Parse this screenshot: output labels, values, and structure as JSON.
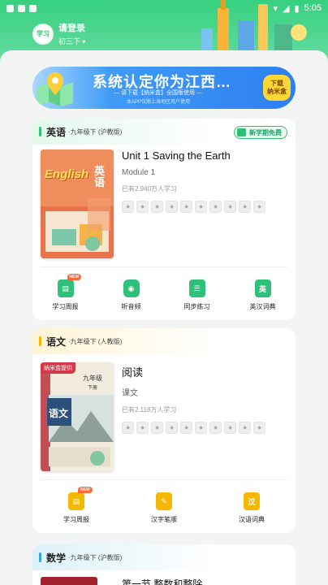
{
  "status_bar": {
    "time": "5:05"
  },
  "header": {
    "avatar_text": "学习",
    "login_label": "请登录",
    "grade_label": "初三下"
  },
  "banner": {
    "title": "系统认定你为江西…",
    "subtitle": "— 请下载【纳米盒】全国版使用 —",
    "note": "本APP仅限上海地区用户使用",
    "button_label": "下载\n纳米盒"
  },
  "english_card": {
    "subject": "英语",
    "edition": "·九年级下 (沪教版)",
    "tag": "新学期免费",
    "book_cover_en": "English",
    "book_cover_cn": "英语",
    "lesson": "Unit 1 Saving the Earth",
    "module": "Module 1",
    "learners": "已有2.940万人学习",
    "features": [
      {
        "label": "学习周报",
        "icon": "weekly-report-icon",
        "new": "NEW"
      },
      {
        "label": "听音频",
        "icon": "audio-icon"
      },
      {
        "label": "同步练习",
        "icon": "practice-book-icon"
      },
      {
        "label": "英汉词典",
        "icon": "dictionary-icon",
        "glyph": "英"
      }
    ]
  },
  "chinese_card": {
    "subject": "语文",
    "edition": "·九年级下 (人教版)",
    "book_badge": "纳米盒提供",
    "book_title": "九年级",
    "book_subtitle": "下册",
    "book_name": "语文",
    "lesson": "阅读",
    "module": "课文",
    "learners": "已有2.118万人学习",
    "features": [
      {
        "label": "学习周报",
        "icon": "weekly-report-icon",
        "new": "NEW"
      },
      {
        "label": "汉字笔顺",
        "icon": "stroke-order-icon"
      },
      {
        "label": "汉语词典",
        "icon": "chinese-dictionary-icon",
        "glyph": "汉"
      }
    ]
  },
  "math_card": {
    "subject": "数学",
    "edition": "·九年级下 (沪教版)",
    "lesson": "第一节 整数和整除"
  },
  "colors": {
    "primary_green": "#36d07f",
    "banner_blue": "#2d7ff0",
    "feature_green": "#2fc07a",
    "feature_yellow": "#f5b800"
  }
}
